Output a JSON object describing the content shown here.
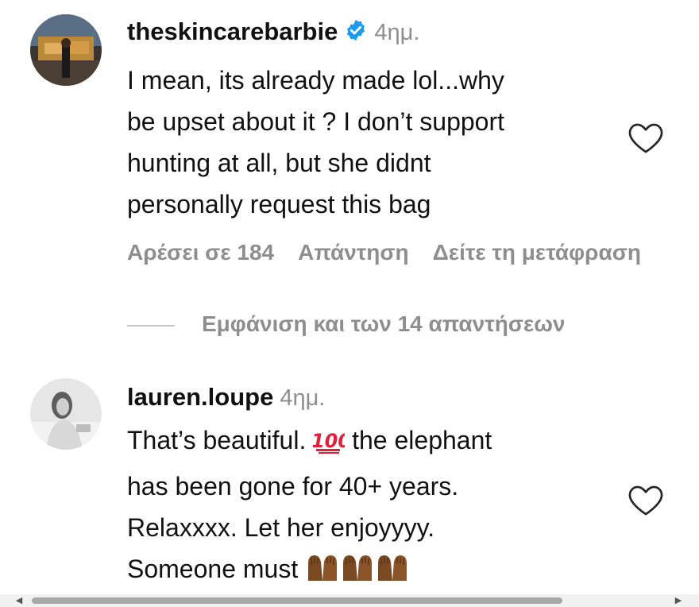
{
  "comments": [
    {
      "username": "theskincarebarbie",
      "verified": true,
      "time": "4ημ.",
      "lines": [
        "I mean, its already made lol...why",
        "be upset about it ? I don’t support",
        "hunting at all, but she didnt",
        "personally request this bag"
      ],
      "actions": {
        "likes": "Αρέσει σε 184",
        "reply": "Απάντηση",
        "translate": "Δείτε τη μετάφραση"
      },
      "view_replies": "Εμφάνιση και των 14 απαντήσεων"
    },
    {
      "username": "lauren.loupe",
      "verified": false,
      "time": "4ημ.",
      "lines": [
        "That’s beautiful.",
        "the elephant",
        "has been gone for 40+ years.",
        "Relaxxxx. Let her enjoyyyy.",
        "Someone must"
      ],
      "emojis": [
        "hundred-points",
        "raised-hands",
        "raised-hands",
        "raised-hands"
      ]
    }
  ],
  "colors": {
    "text": "#111111",
    "secondary_text": "#8e8e8e",
    "verified_badge": "#1d9bf0",
    "scrollbar_thumb": "#a8a8a8"
  },
  "icons": [
    "verified-badge-icon",
    "heart-icon",
    "hundred-points-emoji",
    "raised-hands-emoji",
    "scroll-left-arrow-icon",
    "scroll-right-arrow-icon"
  ]
}
